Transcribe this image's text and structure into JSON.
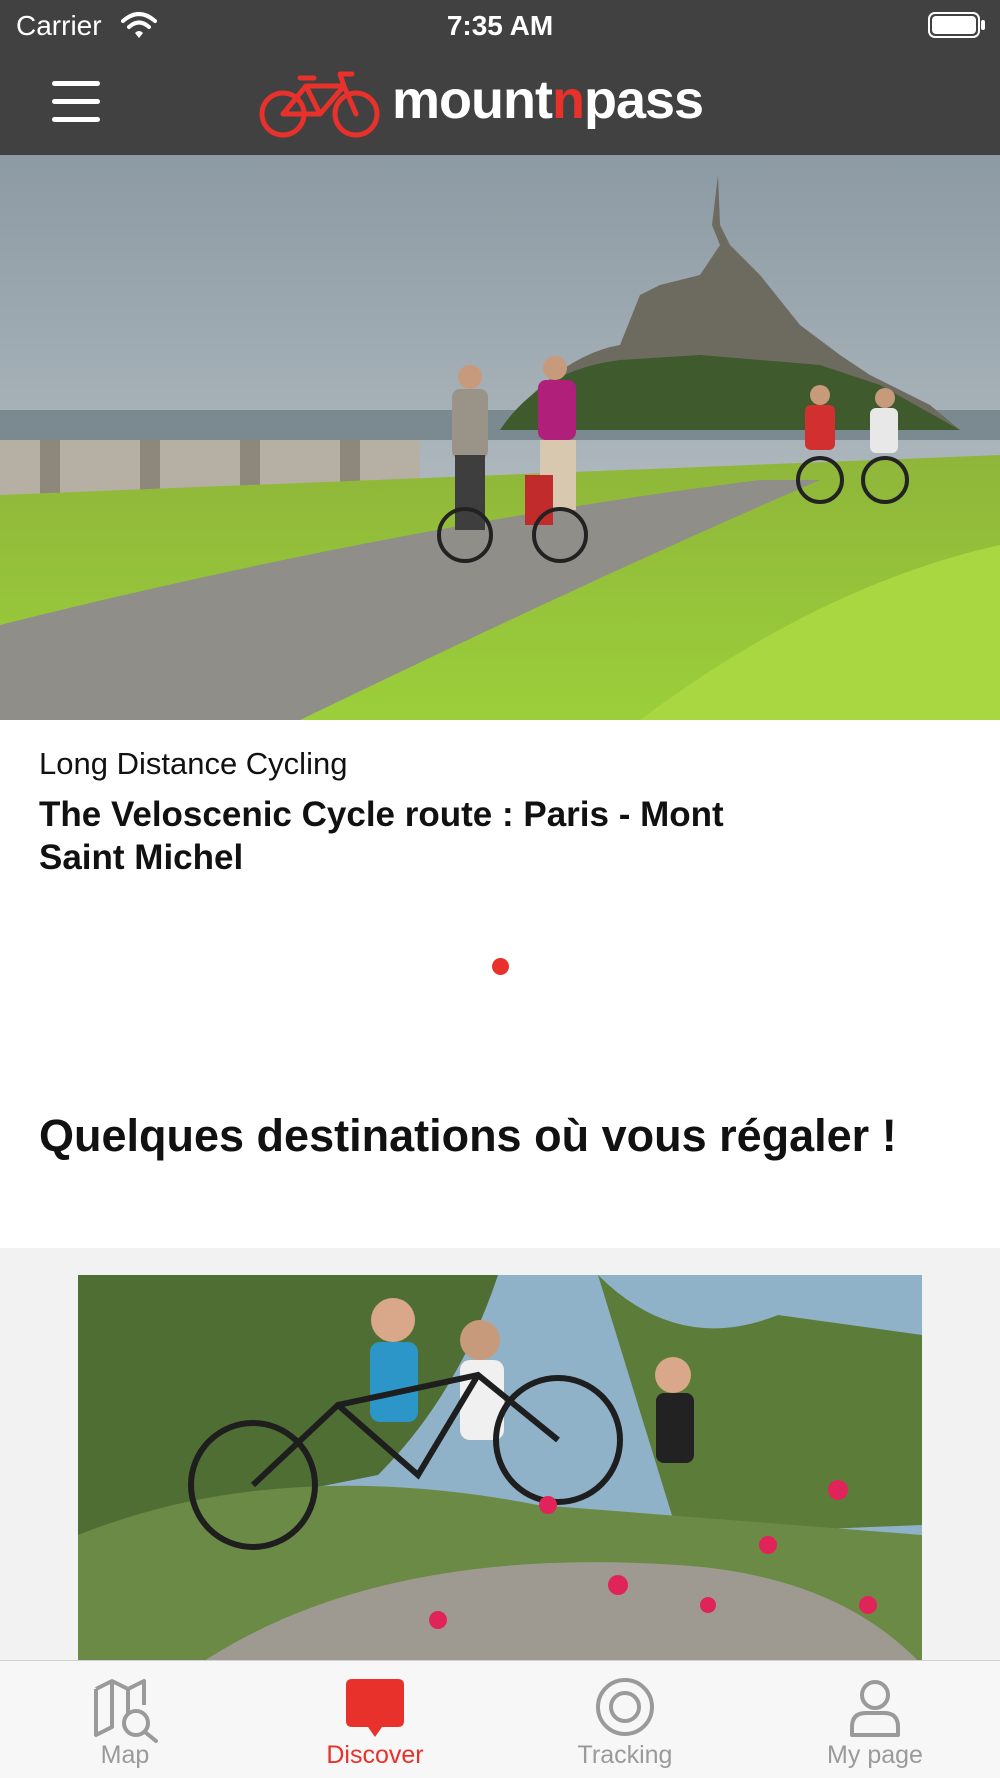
{
  "status_bar": {
    "carrier": "Carrier",
    "time": "7:35 AM"
  },
  "header": {
    "logo": {
      "text_before": "mount",
      "text_accent": "n",
      "text_after": "pass"
    },
    "icons": {
      "menu": "hamburger-menu-icon",
      "logo": "bicycle-logo-icon"
    }
  },
  "hero": {
    "image": "cyclists-mont-saint-michel-photo",
    "category": "Long Distance Cycling",
    "title": "The Veloscenic Cycle route : Paris - Mont Saint Michel",
    "page_indicator": {
      "pages": 1,
      "current": 1
    }
  },
  "section": {
    "heading": "Quelques destinations où vous régaler !"
  },
  "destination_card": {
    "image": "family-cyclists-on-rock-photo"
  },
  "tab_bar": {
    "tabs": [
      {
        "label": "Map",
        "icon": "map-search-icon",
        "active": false
      },
      {
        "label": "Discover",
        "icon": "discover-bubble-icon",
        "active": true
      },
      {
        "label": "Tracking",
        "icon": "tracking-target-icon",
        "active": false
      },
      {
        "label": "My page",
        "icon": "user-icon",
        "active": false
      }
    ]
  },
  "colors": {
    "header_bg": "#414141",
    "accent": "#e8312b",
    "tab_inactive": "#9a9a9a",
    "gray_area": "#f2f2f2"
  }
}
